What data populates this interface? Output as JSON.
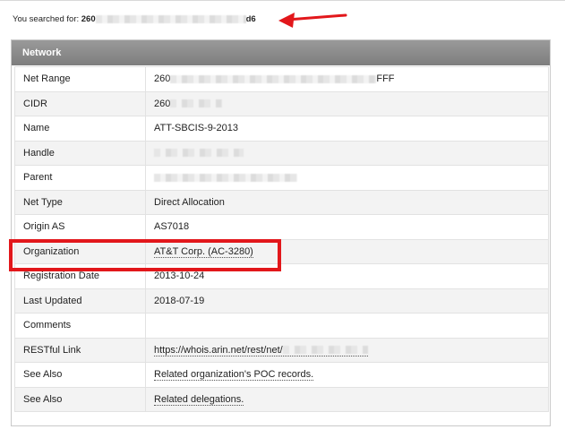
{
  "search": {
    "label": "You searched for:",
    "query_prefix": "260",
    "query_suffix": "d6"
  },
  "panel": {
    "title": "Network",
    "rows": [
      {
        "key": "Net Range",
        "value": "260",
        "value_suffix": "FFF"
      },
      {
        "key": "CIDR",
        "value": "260"
      },
      {
        "key": "Name",
        "value": "ATT-SBCIS-9-2013"
      },
      {
        "key": "Handle",
        "value": ""
      },
      {
        "key": "Parent",
        "value": ""
      },
      {
        "key": "Net Type",
        "value": "Direct Allocation"
      },
      {
        "key": "Origin AS",
        "value": "AS7018"
      },
      {
        "key": "Organization",
        "value": "AT&T Corp. (AC-3280)"
      },
      {
        "key": "Registration Date",
        "value": "2013-10-24"
      },
      {
        "key": "Last Updated",
        "value": "2018-07-19"
      },
      {
        "key": "Comments",
        "value": ""
      },
      {
        "key": "RESTful Link",
        "value": "https://whois.arin.net/rest/net/"
      },
      {
        "key": "See Also",
        "value": "Related organization's POC records."
      },
      {
        "key": "See Also",
        "value": "Related delegations."
      }
    ]
  },
  "colors": {
    "header_bg": "#8a8a8a",
    "highlight": "#e2171b",
    "arrow": "#e2171b",
    "alt_row": "#f3f3f3"
  },
  "annotations": {
    "arrow_icon": "red-arrow-icon",
    "highlight": "organization-highlight-box"
  }
}
